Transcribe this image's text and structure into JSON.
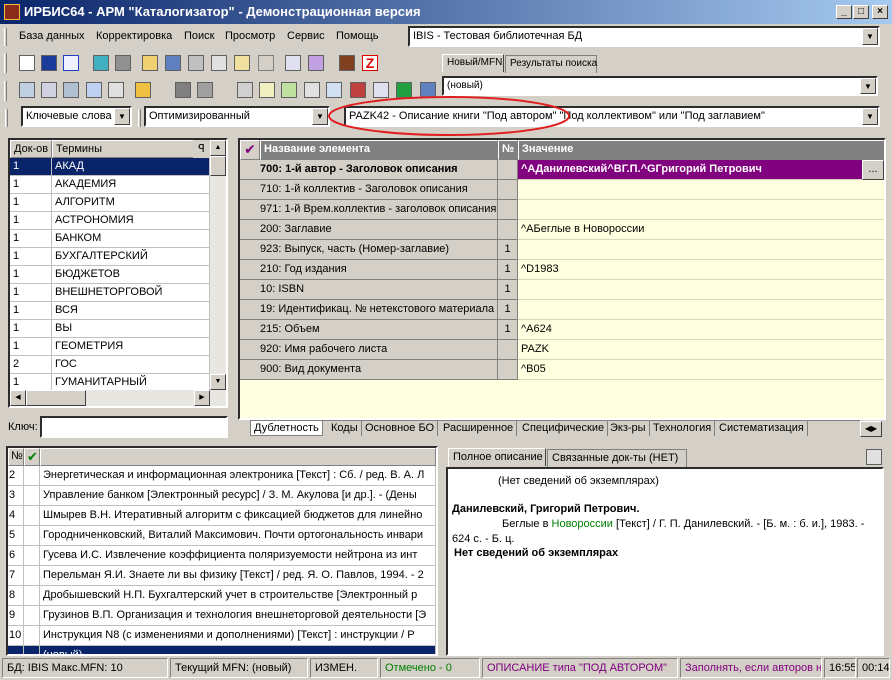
{
  "window": {
    "title": "ИРБИС64 - АРМ \"Каталогизатор\" - Демонстрационная версия",
    "minimize": "_",
    "maximize": "□",
    "close": "×"
  },
  "menu": [
    "База данных",
    "Корректировка",
    "Поиск",
    "Просмотр",
    "Сервис",
    "Помощь"
  ],
  "database_combo": {
    "value": "IBIS - Тестовая библиотечная БД"
  },
  "record_tabs": [
    "Новый/MFN",
    "Результаты поиска"
  ],
  "record_combo": {
    "value": "(новый)"
  },
  "search": {
    "dictionary_combo": "Ключевые слова",
    "mode_combo": "Оптимизированный",
    "worksheet_combo": "PAZK42 - Описание книги \"Под автором\" \"Под коллективом\" или \"Под заглавием\"",
    "key_label": "Ключ:",
    "key_value": ""
  },
  "dictionary": {
    "headers": [
      "Док-ов",
      "Термины"
    ],
    "rows": [
      {
        "count": "1",
        "term": "АКАД"
      },
      {
        "count": "1",
        "term": "АКАДЕМИЯ"
      },
      {
        "count": "1",
        "term": "АЛГОРИТМ"
      },
      {
        "count": "1",
        "term": "АСТРОНОМИЯ"
      },
      {
        "count": "1",
        "term": "БАНКОМ"
      },
      {
        "count": "1",
        "term": "БУХГАЛТЕРСКИЙ"
      },
      {
        "count": "1",
        "term": "БЮДЖЕТОВ"
      },
      {
        "count": "1",
        "term": "ВНЕШНЕТОРГОВОЙ"
      },
      {
        "count": "1",
        "term": "ВСЯ"
      },
      {
        "count": "1",
        "term": "ВЫ"
      },
      {
        "count": "1",
        "term": "ГЕОМЕТРИЯ"
      },
      {
        "count": "2",
        "term": "ГОС"
      },
      {
        "count": "1",
        "term": "ГУМАНИТАРНЫЙ"
      }
    ]
  },
  "worksheet": {
    "headers": [
      "Название элемента",
      "№",
      "Значение"
    ],
    "rows": [
      {
        "name": "700: 1-й  автор - Заголовок описания",
        "num": "",
        "value": "^AДанилевский^BГ.П.^GГригорий Петрович"
      },
      {
        "name": "710: 1-й коллектив - Заголовок описания",
        "num": "",
        "value": ""
      },
      {
        "name": "971: 1-й Врем.коллектив - заголовок описания",
        "num": "",
        "value": ""
      },
      {
        "name": "200: Заглавие",
        "num": "",
        "value": "^AБеглые в Новороссии"
      },
      {
        "name": "923: Выпуск, часть (Номер-заглавие)",
        "num": "1",
        "value": ""
      },
      {
        "name": "210: Год издания",
        "num": "1",
        "value": "^D1983"
      },
      {
        "name": "10: ISBN",
        "num": "1",
        "value": ""
      },
      {
        "name": "19: Идентификац. № нетекстового материала",
        "num": "1",
        "value": ""
      },
      {
        "name": "215: Объем",
        "num": "1",
        "value": "^A624"
      },
      {
        "name": "920: Имя рабочего листа",
        "num": "",
        "value": "PAZK"
      },
      {
        "name": "900: Вид документа",
        "num": "",
        "value": "^B05"
      }
    ],
    "ellipsis": "..."
  },
  "worksheet_tabs": [
    "Дублетность",
    "Коды",
    "Основное БО",
    "Расширенное",
    "Специфические",
    "Экз-ры",
    "Технология",
    "Систематизация"
  ],
  "results": {
    "header": "№",
    "rows": [
      {
        "num": "2",
        "text": "Энергетическая и информационная электроника [Текст] : Сб. / ред. В. А. Л"
      },
      {
        "num": "3",
        "text": "Управление банком [Электронный ресурс]  / З. М. Акулова [и др.]. - (Дены"
      },
      {
        "num": "4",
        "text": "Шмырев В.Н. Итеративный алгоритм с фиксацией бюджетов для линейно"
      },
      {
        "num": "5",
        "text": "Городниченковский, Виталий Максимович. Почти ортогональность инвари"
      },
      {
        "num": "6",
        "text": "Гусева И.С. Извлечение коэффициента поляризуемости нейтрона из инт"
      },
      {
        "num": "7",
        "text": "Перельман Я.И. Знаете ли вы физику [Текст] / ред. Я. О. Павлов, 1994. - 2"
      },
      {
        "num": "8",
        "text": "Дробышевский Н.П. Бухгалтерский учет в строительстве [Электронный р"
      },
      {
        "num": "9",
        "text": "Грузинов В.П. Организация и технология внешнеторговой деятельности [Э"
      },
      {
        "num": "10",
        "text": "Инструкция N8   (с изменениями и дополнениями) [Текст] : инструкции / Р"
      },
      {
        "num": "",
        "text": "(новый)"
      }
    ]
  },
  "preview_tabs": [
    "Полное описание",
    "Связанные док-ты (НЕТ)"
  ],
  "preview": {
    "line1": "(Нет сведений об экземплярах)",
    "author": "Данилевский, Григорий Петрович.",
    "desc_pre": "Беглые в ",
    "desc_link": "Новороссии",
    "desc_post": " [Текст] / Г. П. Данилевский. - [Б. м. : б. и.], 1983. -",
    "desc_line2": "624 с. - Б. ц.",
    "no_copies": "Нет сведений об экземплярах"
  },
  "statusbar": {
    "db": "БД: IBIS Макс.MFN: 10",
    "current": "Текущий MFN: (новый)",
    "modified": "ИЗМЕН.",
    "marked": "Отмечено - 0",
    "desc_type": "ОПИСАНИЕ типа \"ПОД АВТОРОМ\"",
    "hint": "Заполнять, если авторов н",
    "time": "16:55",
    "date": "00:14"
  },
  "colors": {
    "title_start": "#0a246a",
    "selection": "#0a246a",
    "active_row": "#800080",
    "highlight_ellipse": "#e02020",
    "value_bg": "#ffffe0",
    "green_status": "#008000",
    "purple_status": "#800080"
  }
}
